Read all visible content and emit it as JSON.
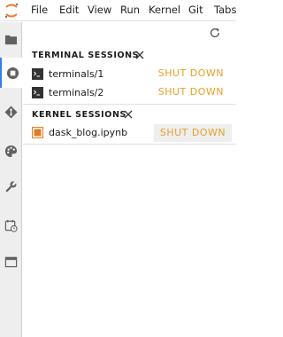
{
  "menubar": {
    "logo": "jupyter-logo-icon",
    "items": [
      "File",
      "Edit",
      "View",
      "Run",
      "Kernel",
      "Git",
      "Tabs"
    ]
  },
  "sidebar_rail": {
    "icons": [
      "folder-icon",
      "running-sessions-icon",
      "git-icon",
      "palette-icon",
      "wrench-icon",
      "history-icon",
      "tabs-icon"
    ],
    "active": "running-sessions-icon"
  },
  "running_panel": {
    "refresh_icon": "refresh-icon",
    "terminal_sessions": {
      "title": "TERMINAL SESSIONS",
      "items": [
        {
          "label": "terminals/1",
          "action": "SHUT DOWN"
        },
        {
          "label": "terminals/2",
          "action": "SHUT DOWN"
        }
      ]
    },
    "kernel_sessions": {
      "title": "KERNEL SESSIONS",
      "items": [
        {
          "label": "dask_blog.ipynb",
          "action": "SHUT DOWN"
        }
      ]
    }
  },
  "colors": {
    "accent": "#e8a025",
    "active_indicator": "#2f80ed",
    "rail_background": "#eeeeee"
  }
}
